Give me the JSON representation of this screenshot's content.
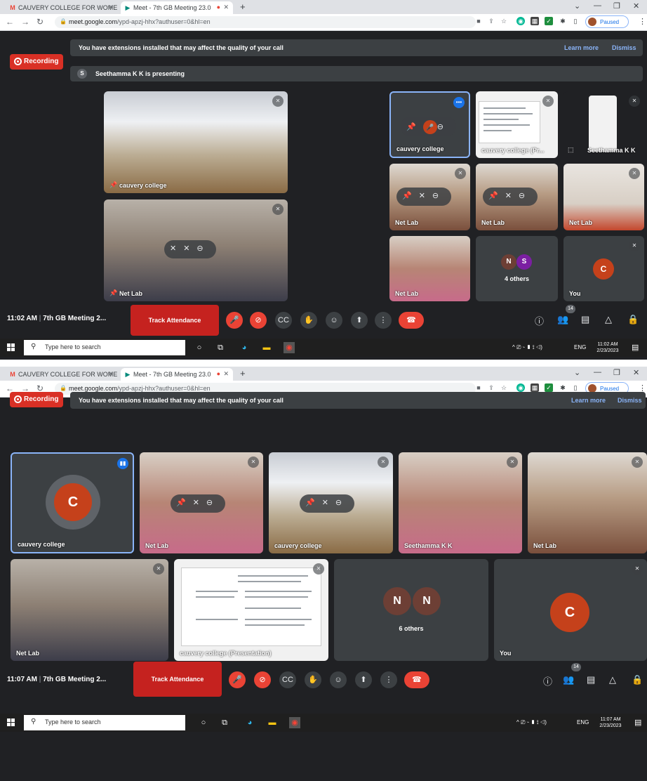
{
  "browser": {
    "tab1_title": "CAUVERY COLLEGE FOR WOMEN",
    "tab2_title": "Meet - 7th GB Meeting 23.0",
    "url_host": "meet.google.com",
    "url_path": "/ypd-apzj-hhx?authuser=0&hl=en",
    "profile_status": "Paused",
    "icons": [
      "gmail-icon",
      "meet-icon",
      "recording-dot-icon",
      "close-icon",
      "new-tab-icon",
      "back-icon",
      "forward-icon",
      "reload-icon",
      "lock-icon",
      "camera-icon",
      "share-icon",
      "star-icon",
      "extension-icon",
      "puzzle-icon",
      "sidepanel-icon",
      "kebab-icon"
    ]
  },
  "meet1": {
    "recording_label": "Recording",
    "banner_text": "You have extensions installed that may affect the quality of your call",
    "learn_more": "Learn more",
    "dismiss": "Dismiss",
    "presenting_initial": "S",
    "presenting_text": "Seethamma K K is presenting",
    "tiles": {
      "cauvery_room": "cauvery college",
      "net_lab_speaker": "Net Lab",
      "cauvery_selected": "cauvery college",
      "presentation": "cauvery college (Pr...",
      "seethamma": "Seethamma K K",
      "net_lab_1": "Net Lab",
      "net_lab_2": "Net Lab",
      "net_lab_3": "Net Lab",
      "net_lab_4": "Net Lab",
      "others_initial_1": "N",
      "others_initial_2": "S",
      "others_label": "4 others",
      "you_initial": "C",
      "you_label": "You"
    },
    "meeting_time": "11:02 AM",
    "meeting_title": "7th GB Meeting 2...",
    "track_attendance": "Track Attendance",
    "participants_count": "14",
    "clock_time": "11:02 AM",
    "clock_date": "2/23/2023"
  },
  "meet2": {
    "recording_label": "Recording",
    "banner_text": "You have extensions installed that may affect the quality of your call",
    "learn_more": "Learn more",
    "dismiss": "Dismiss",
    "tiles": {
      "cauvery_selected": "cauvery college",
      "cauvery_initial": "C",
      "net_lab_woman": "Net Lab",
      "cauvery_room": "cauvery college",
      "seethamma": "Seethamma K K",
      "net_lab_man": "Net Lab",
      "net_lab_elder": "Net Lab",
      "presentation": "cauvery college (Presentation)",
      "others_initial_1": "N",
      "others_initial_2": "N",
      "others_label": "6 others",
      "you_initial": "C",
      "you_label": "You"
    },
    "meeting_time": "11:07 AM",
    "meeting_title": "7th GB Meeting 2...",
    "track_attendance": "Track Attendance",
    "participants_count": "14",
    "clock_time": "11:07 AM",
    "clock_date": "2/23/2023"
  },
  "taskbar": {
    "search_placeholder": "Type here to search",
    "language": "ENG"
  },
  "colors": {
    "meet_bg": "#202124",
    "tile_bg": "#3c4043",
    "recording_red": "#d93025",
    "hangup_red": "#ea4335",
    "link_blue": "#8ab4f8",
    "avatar_orange": "#c5411b"
  }
}
